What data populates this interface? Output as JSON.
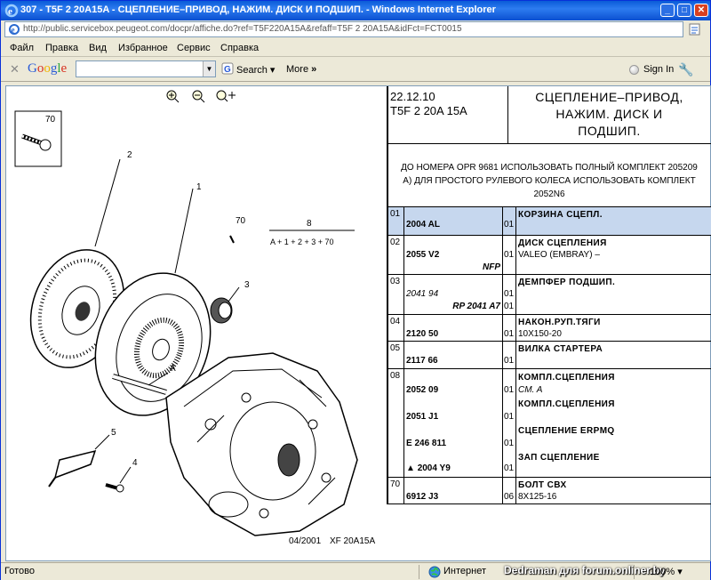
{
  "window": {
    "title": "307 - T5F 2 20A15A - СЦЕПЛЕНИЕ–ПРИВОД, НАЖИМ. ДИСК И ПОДШИП. - Windows Internet Explorer",
    "buttons": {
      "minimize": "_",
      "maximize": "□",
      "close": "✕"
    }
  },
  "address": {
    "url": "http://public.servicebox.peugeot.com/docpr/affiche.do?ref=T5F220A15A&refaff=T5F 2 20A15A&idFct=FCT0015"
  },
  "menu": [
    "Файл",
    "Правка",
    "Вид",
    "Избранное",
    "Сервис",
    "Справка"
  ],
  "google_toolbar": {
    "close": "✕",
    "logo": "Google",
    "search_label": "Search",
    "more_label": "More",
    "more_arrows": "»",
    "signin_label": "Sign In"
  },
  "drawing": {
    "labels": {
      "n70_box": "70",
      "n2": "2",
      "n1": "1",
      "n70": "70",
      "n8": "8",
      "formula": "A + 1 + 2 + 3 + 70",
      "n3": "3",
      "nA": "A",
      "n5": "5",
      "n4": "4",
      "footer_date": "04/2001",
      "footer_code": "XF 20A15A"
    }
  },
  "panel": {
    "date": "22.12.10",
    "code": "T5F 2 20A 15A",
    "title_lines": [
      "СЦЕПЛЕНИЕ–ПРИВОД,",
      "НАЖИМ. ДИСК И",
      "ПОДШИП."
    ],
    "note_lines": [
      "ДО НОМЕРА OPR 9681 ИСПОЛЬЗОВАТЬ ПОЛНЫЙ КОМПЛЕКТ 205209",
      "А) ДЛЯ ПРОСТОГО РУЛЕВОГО КОЛЕСА ИСПОЛЬЗОВАТЬ КОМПЛЕКТ",
      "2052N6"
    ],
    "rows": [
      {
        "num": "01",
        "ref": "2004 AL",
        "qty": "01",
        "desc": "КОРЗИНА СЦЕПЛ."
      },
      {
        "num": "02",
        "ref": "2055 V2",
        "ref2": "NFP",
        "qty": "01",
        "desc": "ДИСК СЦЕПЛЕНИЯ",
        "sub": "VALEO (EMBRAY) –"
      },
      {
        "num": "03",
        "ref": "2041 94",
        "ref2": "RP 2041 A7",
        "qty": "01",
        "qty2": "01",
        "desc": "ДЕМПФЕР ПОДШИП."
      },
      {
        "num": "04",
        "ref": "2120 50",
        "qty": "01",
        "desc": "НАКОН.РУП.ТЯГИ",
        "sub": "10X150-20"
      },
      {
        "num": "05",
        "ref": "2117 66",
        "qty": "01",
        "desc": "ВИЛКА СТАРТЕРА"
      },
      {
        "num": "08",
        "refs": [
          "2052 09",
          "2051 J1",
          "E 246 811",
          "2004 Y9"
        ],
        "qtys": [
          "01",
          "01",
          "01",
          "01"
        ],
        "descs": [
          "КОМПЛ.СЦЕПЛЕНИЯ",
          "КОМПЛ.СЦЕПЛЕНИЯ",
          "СЦЕПЛЕНИЕ ERPMQ",
          "ЗАП СЦЕПЛЕНИЕ"
        ],
        "sub": "CM. A",
        "flag": "▲"
      },
      {
        "num": "70",
        "ref": "6912 J3",
        "qty": "06",
        "desc": "БОЛТ СВХ",
        "sub": "8X125-16"
      }
    ]
  },
  "status": {
    "text": "Готово",
    "zone": "Интернет",
    "watermark": "Dedraman для forum.onliner.by",
    "zoom": "100%",
    "zoom_arrow": "▾"
  }
}
